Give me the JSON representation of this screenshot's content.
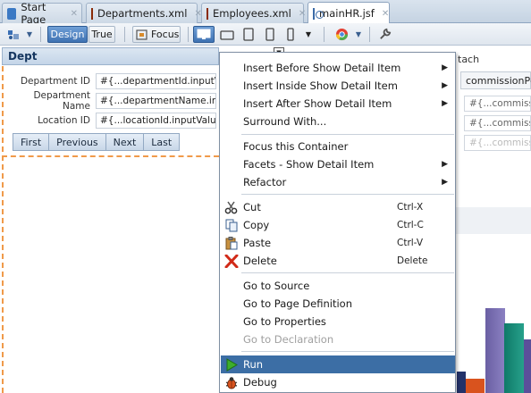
{
  "tabs": [
    {
      "label": "Start Page",
      "icon": "start-page-icon"
    },
    {
      "label": "Departments.xml",
      "icon": "xml-file-icon"
    },
    {
      "label": "Employees.xml",
      "icon": "xml-file-icon"
    },
    {
      "label": "mainHR.jsf",
      "icon": "jsf-file-icon",
      "active": true
    }
  ],
  "toolbar": {
    "design_label": "Design",
    "true_label": "True",
    "focus_label": "Focus"
  },
  "dept": {
    "title": "Dept",
    "fields": [
      {
        "label": "Department ID",
        "value": "#{...departmentId.inputValue}"
      },
      {
        "label": "Department Name",
        "value": "#{...departmentName.inputValue}"
      },
      {
        "label": "Location ID",
        "value": "#{...locationId.inputValue}"
      }
    ],
    "nav": [
      "First",
      "Previous",
      "Next",
      "Last"
    ]
  },
  "right_panel": {
    "attach_label": "tach",
    "column_header": "commissionPct",
    "cells": [
      "#{...commissi",
      "#{...commissi",
      "#{...commissi"
    ]
  },
  "context_menu": {
    "items": [
      {
        "label": "Insert Before Show Detail Item",
        "submenu": true
      },
      {
        "label": "Insert Inside Show Detail Item",
        "submenu": true
      },
      {
        "label": "Insert After Show Detail Item",
        "submenu": true
      },
      {
        "label": "Surround With...",
        "submenu": false
      },
      {
        "label": "Focus this Container",
        "submenu": false
      },
      {
        "label": "Facets - Show Detail Item",
        "submenu": true
      },
      {
        "label": "Refactor",
        "submenu": true
      },
      {
        "label": "Cut",
        "shortcut": "Ctrl-X",
        "icon": "scissors-icon"
      },
      {
        "label": "Copy",
        "shortcut": "Ctrl-C",
        "icon": "copy-icon"
      },
      {
        "label": "Paste",
        "shortcut": "Ctrl-V",
        "icon": "paste-icon"
      },
      {
        "label": "Delete",
        "shortcut": "Delete",
        "icon": "delete-x-icon"
      },
      {
        "label": "Go to Source"
      },
      {
        "label": "Go to Page Definition"
      },
      {
        "label": "Go to Properties"
      },
      {
        "label": "Go to Declaration",
        "disabled": true
      },
      {
        "label": "Run",
        "icon": "run-icon",
        "selected": true
      },
      {
        "label": "Debug",
        "icon": "debug-icon"
      }
    ]
  },
  "colors": {
    "accent": "#3c6ea5",
    "design_button": "#4a7dbd",
    "dashed_border": "#f09a4a",
    "chart_purple": "#7a6fb0",
    "chart_teal": "#1a8a78",
    "chart_orange": "#d9531e",
    "chart_navy": "#23326a"
  }
}
